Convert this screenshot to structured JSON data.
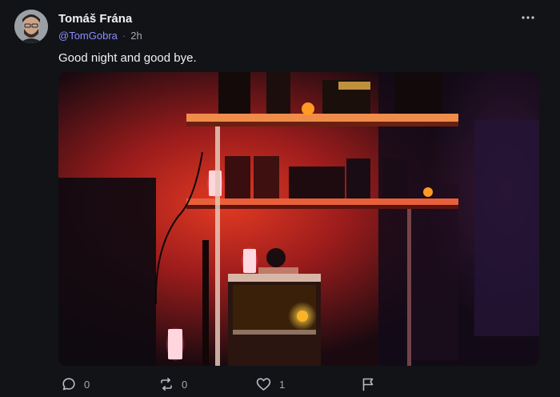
{
  "post": {
    "author": {
      "display_name": "Tomáš Frána",
      "handle": "@TomGobra",
      "separator": "·",
      "time": "2h"
    },
    "text": "Good night and good bye.",
    "menu_icon": "more-horizontal-icon",
    "image_icon": "photo"
  },
  "actions": {
    "reply": {
      "icon": "reply-icon",
      "count": "0"
    },
    "repost": {
      "icon": "repost-icon",
      "count": "0"
    },
    "like": {
      "icon": "heart-icon",
      "count": "1"
    },
    "report": {
      "icon": "flag-icon"
    }
  },
  "colors": {
    "background": "#111317",
    "accent_handle": "#8c8dff",
    "muted": "#a3a8b0"
  }
}
